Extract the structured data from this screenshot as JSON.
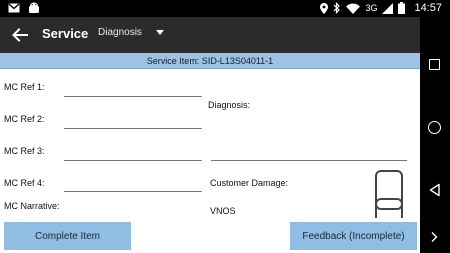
{
  "status_bar": {
    "time": "14:57",
    "network": "3G",
    "icons": [
      "mail-icon",
      "android-icon",
      "location-icon",
      "bluetooth-icon",
      "wifi-icon",
      "signal-icon",
      "battery-icon"
    ]
  },
  "app_bar": {
    "title": "Service",
    "dropdown_value": "Diagnosis"
  },
  "service_item": "Service Item: SID-L13S04011-1",
  "form": {
    "mc_ref_1": "MC Ref 1:",
    "mc_ref_2": "MC Ref 2:",
    "mc_ref_3": "MC Ref 3:",
    "mc_ref_4": "MC Ref 4:",
    "mc_narrative": "MC Narrative:",
    "diagnosis": "Diagnosis:",
    "customer_damage": "Customer Damage:",
    "vnos": "VNOS"
  },
  "buttons": {
    "complete_item": "Complete Item",
    "feedback": "Feedback (Incomplete)"
  },
  "colors": {
    "app_bar": "#2b2b2b",
    "service_bar": "#9cc3e6",
    "button": "#8fbde3"
  }
}
